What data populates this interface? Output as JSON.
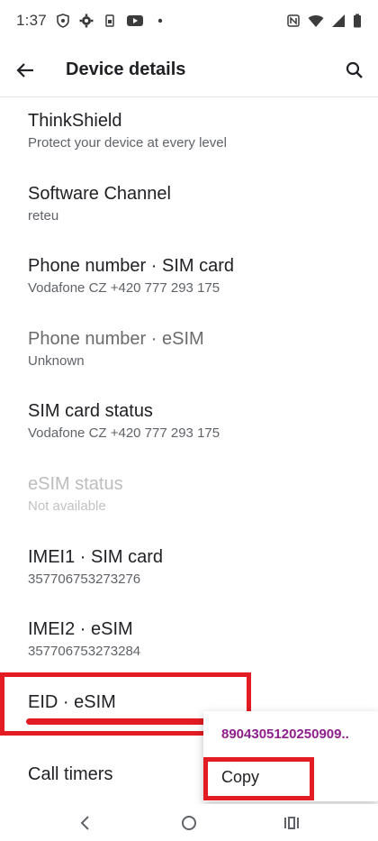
{
  "status_bar": {
    "time": "1:37"
  },
  "app_bar": {
    "title": "Device details"
  },
  "items": [
    {
      "title": "ThinkShield",
      "subtitle": "Protect your device at every level",
      "state": "normal"
    },
    {
      "title": "Software Channel",
      "subtitle": "reteu",
      "state": "normal"
    },
    {
      "title": "Phone number · SIM card",
      "subtitle": "Vodafone CZ +420 777 293 175",
      "state": "normal"
    },
    {
      "title": "Phone number · eSIM",
      "subtitle": "Unknown",
      "state": "muted"
    },
    {
      "title": "SIM card status",
      "subtitle": "Vodafone CZ +420 777 293 175",
      "state": "normal"
    },
    {
      "title": "eSIM status",
      "subtitle": "Not available",
      "state": "disabled"
    },
    {
      "title": "IMEI1 · SIM card",
      "subtitle": "357706753273276",
      "state": "normal"
    },
    {
      "title": "IMEI2 · eSIM",
      "subtitle": "357706753273284",
      "state": "normal"
    },
    {
      "title": "EID · eSIM",
      "subtitle": "",
      "state": "normal"
    },
    {
      "title": "Call timers",
      "subtitle": "",
      "state": "normal"
    }
  ],
  "popup": {
    "eid_preview": "8904305120250909..",
    "copy_label": "Copy"
  },
  "colors": {
    "annotation_red": "#e31b23",
    "eid_text": "#8e1f8c"
  }
}
